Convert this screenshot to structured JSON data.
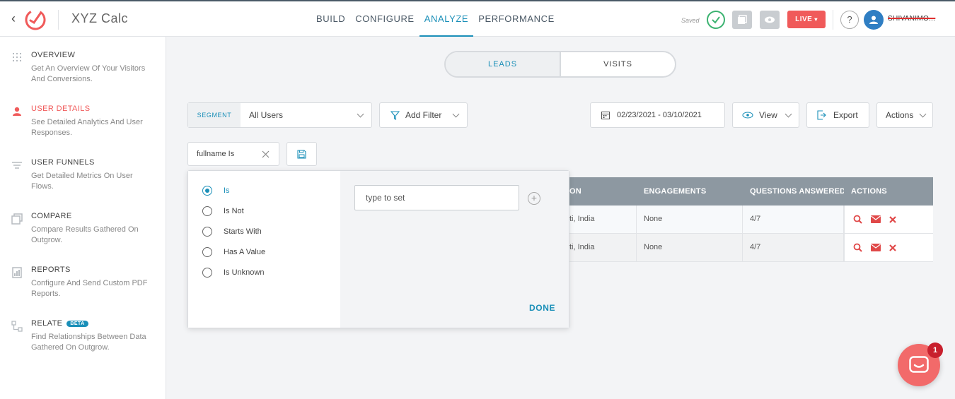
{
  "header": {
    "back_icon": "chevron-left-icon",
    "app_title": "XYZ Calc",
    "nav": [
      {
        "label": "BUILD"
      },
      {
        "label": "CONFIGURE"
      },
      {
        "label": "ANALYZE",
        "active": true
      },
      {
        "label": "PERFORMANCE"
      }
    ],
    "saved_label": "Saved",
    "live_label": "LIVE",
    "help_label": "?",
    "username": "SHIVANIMO..."
  },
  "sidebar": {
    "items": [
      {
        "title": "OVERVIEW",
        "desc": "Get An Overview Of Your Visitors And Conversions.",
        "icon": "grid-icon"
      },
      {
        "title": "USER DETAILS",
        "desc": "See Detailed Analytics And User Responses.",
        "icon": "user-icon",
        "active": true
      },
      {
        "title": "USER FUNNELS",
        "desc": "Get Detailed Metrics On User Flows.",
        "icon": "funnel-icon"
      },
      {
        "title": "COMPARE",
        "desc": "Compare Results Gathered On Outgrow.",
        "icon": "compare-icon"
      },
      {
        "title": "REPORTS",
        "desc": "Configure And Send Custom PDF Reports.",
        "icon": "reports-icon"
      },
      {
        "title": "RELATE",
        "badge": "BETA",
        "desc": "Find Relationships Between Data Gathered On Outgrow.",
        "icon": "relate-icon"
      }
    ]
  },
  "toggle": {
    "leads": "LEADS",
    "visits": "VISITS"
  },
  "filters": {
    "segment_label": "SEGMENT",
    "segment_value": "All Users",
    "add_filter": "Add Filter",
    "date_range": "02/23/2021 - 03/10/2021",
    "view": "View",
    "export": "Export",
    "actions": "Actions",
    "active_filter": "fullname Is"
  },
  "table": {
    "headers": [
      "ON",
      "ENGAGEMENTS",
      "QUESTIONS ANSWERED",
      "ACTIONS"
    ],
    "rows": [
      {
        "location": "ti, India",
        "engagements": "None",
        "answered": "4/7"
      },
      {
        "location": "ti, India",
        "engagements": "None",
        "answered": "4/7"
      }
    ]
  },
  "filter_panel": {
    "options": [
      {
        "label": "Is",
        "checked": true
      },
      {
        "label": "Is Not"
      },
      {
        "label": "Starts With"
      },
      {
        "label": "Has A Value"
      },
      {
        "label": "Is Unknown"
      }
    ],
    "input_placeholder": "type to set",
    "done_label": "DONE"
  },
  "chat": {
    "badge": "1"
  },
  "colors": {
    "accent": "#1a8fb8",
    "live": "#f05a5a",
    "danger": "#e04848",
    "header_gray": "#8d98a1"
  }
}
